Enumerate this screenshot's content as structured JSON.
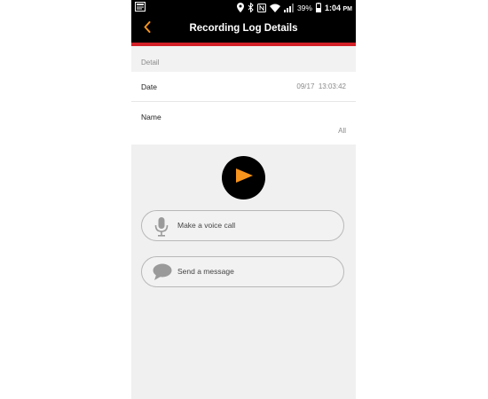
{
  "status_bar": {
    "battery_percent": "39%",
    "time": "1:04",
    "time_suffix": "PM"
  },
  "header": {
    "title": "Recording Log Details",
    "accent_color": "#d32027",
    "back_icon": "chevron-left-icon"
  },
  "detail": {
    "section_label": "Detail",
    "date_label": "Date",
    "date_value": "09/17  13:03:42",
    "name_label": "Name",
    "name_value": "All"
  },
  "player": {
    "play_icon": "play-icon",
    "play_color": "#f7941d"
  },
  "actions": {
    "voice_call_label": "Make a voice call",
    "message_label": "Send a message"
  }
}
